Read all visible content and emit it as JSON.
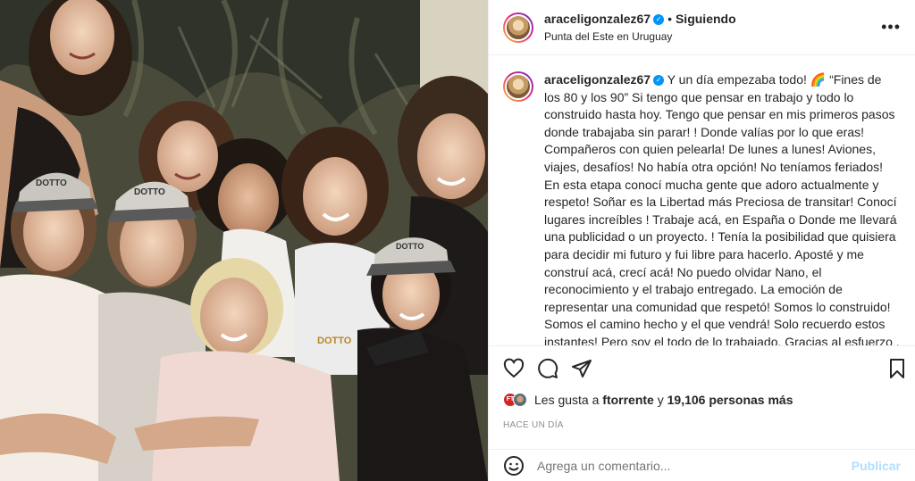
{
  "post": {
    "username": "araceligonzalez67",
    "verified_mark": "✓",
    "separator": "•",
    "follow_status": "Siguiendo",
    "location": "Punta del Este en Uruguay",
    "more_glyph": "•••",
    "photo_text": {
      "cap1": "DOTTO",
      "cap2": "DOTTO",
      "cap3": "DOTTO",
      "shirt": "DOTTO"
    },
    "caption": "Y un día empezaba todo! 🌈 “Fines de los 80 y los 90” Si tengo que pensar en trabajo y todo lo construido hasta hoy. Tengo que pensar en mis primeros pasos donde trabajaba sin parar! ! Donde valías por lo que eras! Compañeros con quien pelearla! De lunes a lunes! Aviones, viajes, desafíos! No había otra opción! No teníamos feriados! En esta etapa conocí mucha gente que adoro actualmente y respeto! Soñar es la Libertad más Preciosa de transitar! Conocí lugares increíbles ! Trabaje acá, en España o Donde me llevará una publicidad o un proyecto. ! Tenía la posibilidad que quisiera para decidir mi futuro y fui libre para hacerlo. Aposté y me construí acá, crecí acá! No puedo olvidar Nano, el reconocimiento y el trabajo entregado. La emoción de representar una comunidad que respetó! Somos lo construido! Somos el camino hecho y el que vendrá! Solo recuerdo estos instantes! Pero soy el todo de lo trabajado. Gracias al esfuerzo , a la entrega! Y al empuje de mi familia en cada triunfo o fracaso! De todo aprendo! De todo decido! 💪🏼♥ Abrzo a todos los que",
    "likes_avatar_initials": "FT",
    "likes_prefix": "Les gusta a",
    "likes_user": "ftorrente",
    "likes_middle": "y",
    "likes_count": "19,106 personas más",
    "time_ago": "HACE UN DÍA",
    "comment_placeholder": "Agrega un comentario...",
    "publish_label": "Publicar"
  },
  "icons": [
    "heart-icon",
    "comment-icon",
    "share-icon",
    "bookmark-icon",
    "emoji-icon",
    "more-options-icon",
    "verified-badge-icon"
  ],
  "colors": {
    "verified": "#0095f6",
    "publish_disabled": "#b2dffc",
    "secondary_text": "#8e8e8e",
    "divider": "#efefef"
  }
}
